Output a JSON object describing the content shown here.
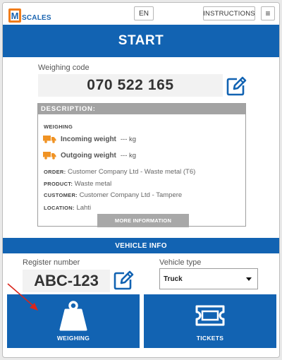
{
  "header": {
    "logo_text": "SCALES",
    "logo_letter": "M",
    "language": "EN",
    "instructions_label": "INSTRUCTIONS",
    "menu_icon": "hamburger-menu-icon"
  },
  "start": {
    "title": "START"
  },
  "weighing_code": {
    "label": "Weighing code",
    "value": "070 522 165"
  },
  "description": {
    "heading": "DESCRIPTION:",
    "section": "WEIGHING",
    "incoming": {
      "label": "Incoming weight",
      "value": "--- kg"
    },
    "outgoing": {
      "label": "Outgoing weight",
      "value": "--- kg"
    },
    "order": {
      "key": "ORDER:",
      "value": "Customer Company Ltd - Waste metal (T6)"
    },
    "product": {
      "key": "PRODUCT:",
      "value": "Waste metal"
    },
    "customer": {
      "key": "CUSTOMER:",
      "value": "Customer Company Ltd - Tampere"
    },
    "location": {
      "key": "LOCATION:",
      "value": "Lahti"
    },
    "more_label": "MORE INFORMATION"
  },
  "vehicle": {
    "heading": "VEHICLE INFO",
    "register_label": "Register number",
    "register_value": "ABC-123",
    "type_label": "Vehicle type",
    "type_value": "Truck"
  },
  "tiles": {
    "weighing_label": "WEIGHING",
    "tickets_label": "TICKETS"
  },
  "colors": {
    "primary": "#1263b2",
    "accent_orange": "#f07c1a",
    "annotation_arrow": "#d9261c"
  }
}
